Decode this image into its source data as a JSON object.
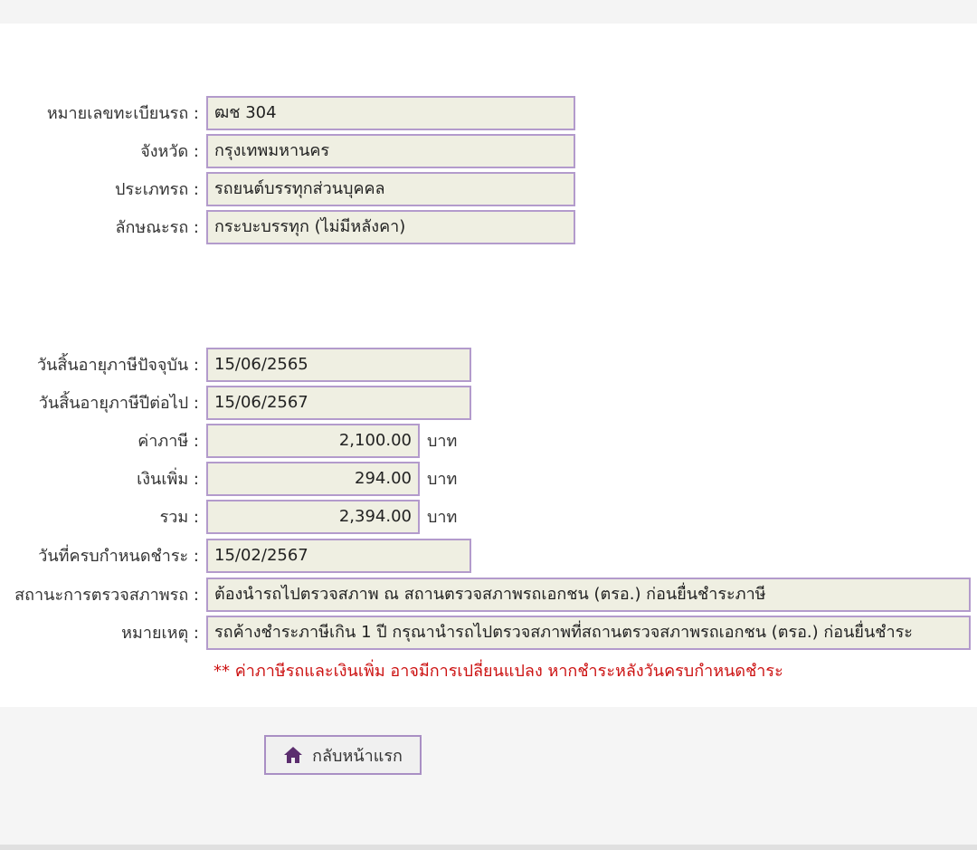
{
  "vehicle": {
    "rows": [
      {
        "label": "หมายเลขทะเบียนรถ :",
        "value": "ฒช 304"
      },
      {
        "label": "จังหวัด :",
        "value": "กรุงเทพมหานคร"
      },
      {
        "label": "ประเภทรถ :",
        "value": "รถยนต์บรรทุกส่วนบุคคล"
      },
      {
        "label": "ลักษณะรถ :",
        "value": "กระบะบรรทุก (ไม่มีหลังคา)"
      }
    ]
  },
  "tax": {
    "current_expiry": {
      "label": "วันสิ้นอายุภาษีปัจจุบัน :",
      "value": "15/06/2565"
    },
    "next_expiry": {
      "label": "วันสิ้นอายุภาษีปีต่อไป :",
      "value": "15/06/2567"
    },
    "tax_amount": {
      "label": "ค่าภาษี :",
      "value": "2,100.00",
      "unit": "บาท"
    },
    "surcharge": {
      "label": "เงินเพิ่ม :",
      "value": "294.00",
      "unit": "บาท"
    },
    "total": {
      "label": "รวม :",
      "value": "2,394.00",
      "unit": "บาท"
    },
    "due_date": {
      "label": "วันที่ครบกำหนดชำระ :",
      "value": "15/02/2567"
    },
    "inspection_status": {
      "label": "สถานะการตรวจสภาพรถ :",
      "value": "ต้องนำรถไปตรวจสภาพ ณ สถานตรวจสภาพรถเอกชน (ตรอ.) ก่อนยื่นชำระภาษี"
    },
    "remark": {
      "label": "หมายเหตุ :",
      "value": "รถค้างชำระภาษีเกิน 1 ปี กรุณานำรถไปตรวจสภาพที่สถานตรวจสภาพรถเอกชน (ตรอ.) ก่อนยื่นชำระ"
    }
  },
  "note": "** ค่าภาษีรถและเงินเพิ่ม อาจมีการเปลี่ยนแปลง หากชำระหลังวันครบกำหนดชำระ",
  "footer": {
    "home_button_label": "กลับหน้าแรก",
    "home_icon": "home-icon"
  },
  "colors": {
    "field_bg": "#efefe2",
    "field_border": "#b39bcc",
    "note": "#cc1111",
    "icon": "#5b2d6e"
  }
}
